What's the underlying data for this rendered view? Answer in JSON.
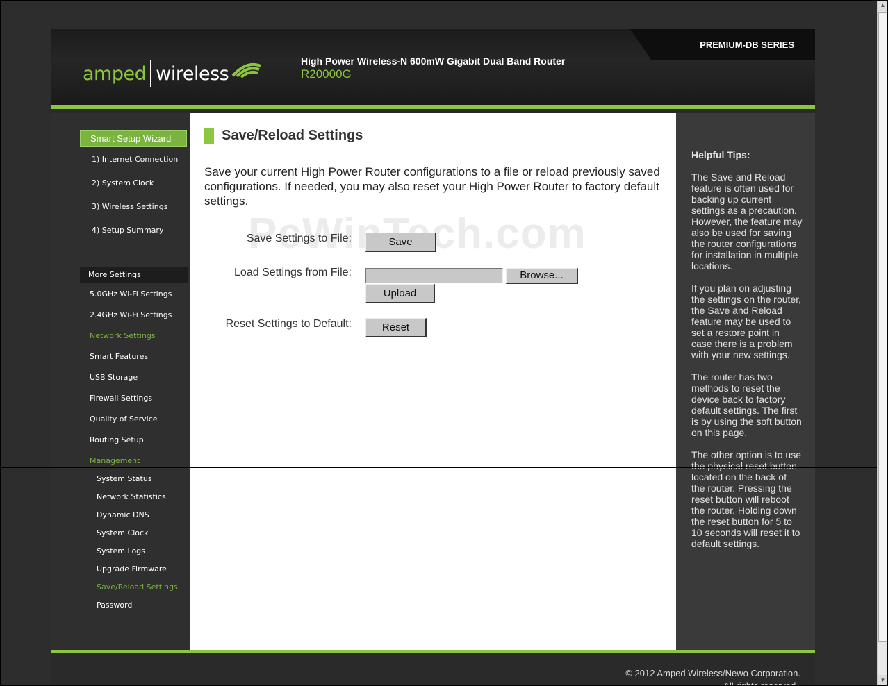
{
  "header": {
    "series": "PREMIUM-DB SERIES",
    "logo_left": "amped",
    "logo_right": "wireless",
    "product_line": "High Power Wireless-N 600mW Gigabit Dual Band Router",
    "model": "R20000G"
  },
  "sidebar": {
    "wizard_title": "Smart Setup Wizard",
    "wizard_items": [
      "1) Internet Connection",
      "2) System Clock",
      "3) Wireless Settings",
      "4) Setup Summary"
    ],
    "more_title": "More Settings",
    "more_items": [
      "5.0GHz Wi-Fi Settings",
      "2.4GHz Wi-Fi Settings",
      "Network Settings",
      "Smart Features",
      "USB Storage",
      "Firewall Settings",
      "Quality of Service",
      "Routing Setup",
      "Management"
    ],
    "management_items": [
      "System Status",
      "Network Statistics",
      "Dynamic DNS",
      "System Clock",
      "System Logs",
      "Upgrade Firmware",
      "Save/Reload Settings",
      "Password"
    ]
  },
  "main": {
    "title": "Save/Reload Settings",
    "intro": "Save your current High Power Router configurations to a file or reload previously saved configurations. If needed, you may also reset your High Power Router to factory default settings.",
    "save_label": "Save Settings to File:",
    "save_button": "Save",
    "load_label": "Load Settings from File:",
    "browse_button": "Browse...",
    "upload_button": "Upload",
    "reset_label": "Reset Settings to Default:",
    "reset_button": "Reset",
    "watermark": "PcWinTech.com"
  },
  "tips": {
    "title": "Helpful Tips:",
    "paragraphs": [
      "The Save and Reload feature is often used for backing up current settings as a precaution. However, the feature may also be used for saving the router configurations for installation in multiple locations.",
      "If you plan on adjusting the settings on the router, the Save and Reload feature may be used to set a restore point in case there is a problem with your new settings.",
      "The router has two methods to reset the device back to factory default settings. The first is by using the soft button on this page.",
      "The other option is to use the physical reset button located on the back of the router. Pressing the reset button will reboot the router. Holding down the reset button for 5 to 10 seconds will reset it to default settings."
    ]
  },
  "footer": {
    "copyright": "© 2012 Amped Wireless/Newo Corporation.",
    "rights": "All rights reserved."
  },
  "colors": {
    "accent": "#8cc63f",
    "background": "#2d2d2d"
  }
}
